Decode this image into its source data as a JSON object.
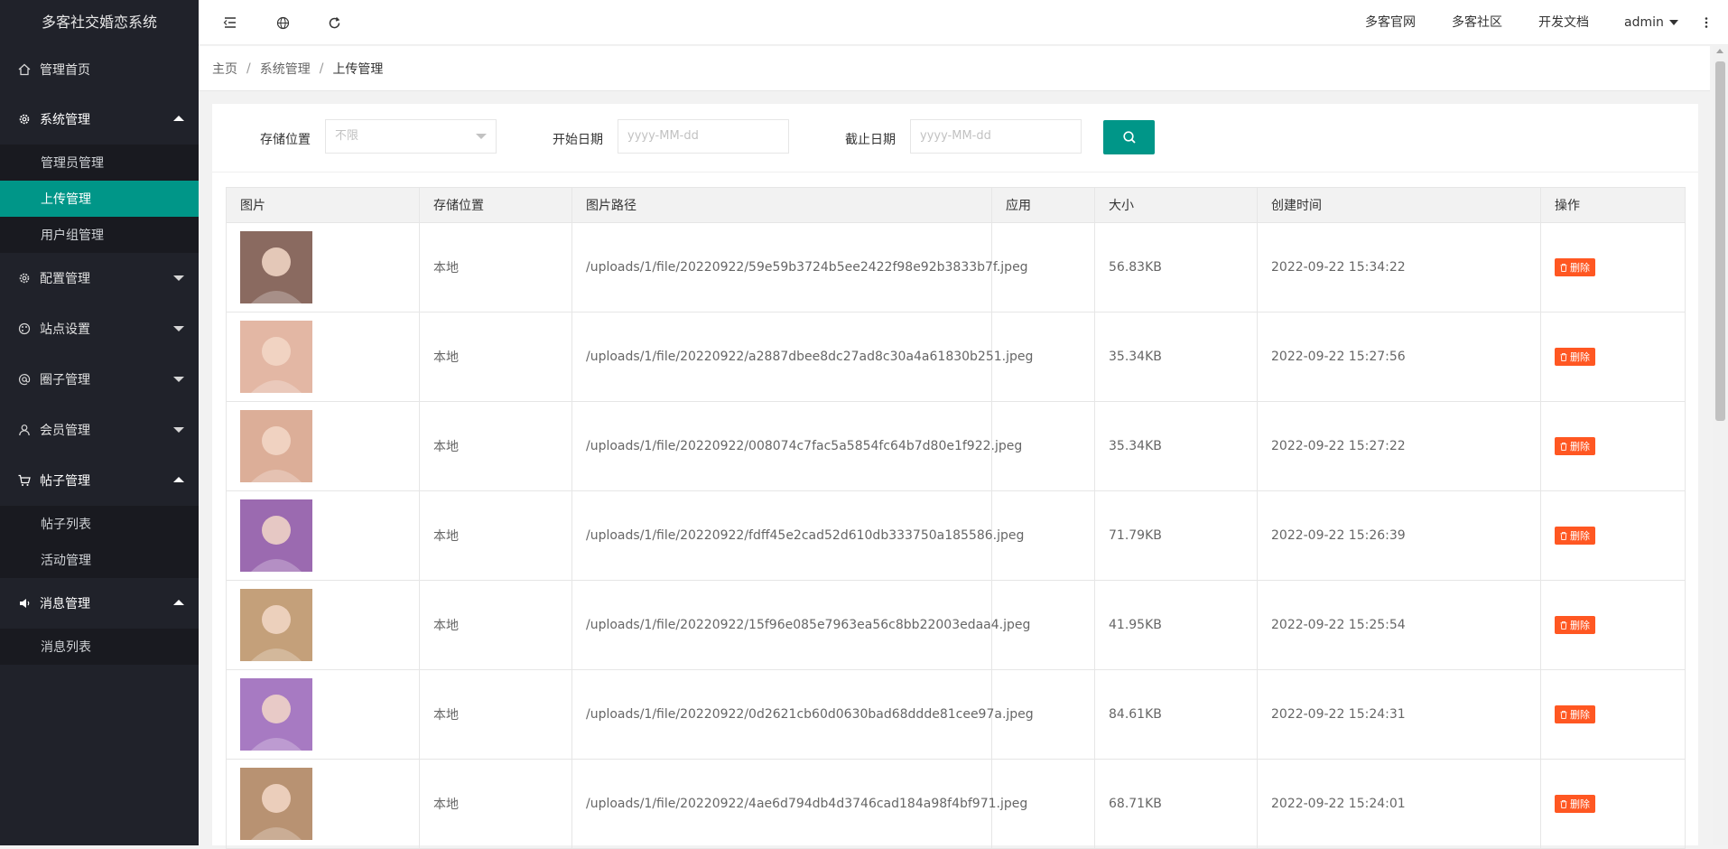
{
  "app": {
    "title": "多客社交婚恋系统"
  },
  "sidebar": {
    "items": [
      {
        "label": "管理首页",
        "icon": "home-icon"
      },
      {
        "label": "系统管理",
        "icon": "gear-icon",
        "expanded": true,
        "children": [
          {
            "label": "管理员管理"
          },
          {
            "label": "上传管理",
            "active": true
          },
          {
            "label": "用户组管理"
          }
        ]
      },
      {
        "label": "配置管理",
        "icon": "settings-icon"
      },
      {
        "label": "站点设置",
        "icon": "palette-icon"
      },
      {
        "label": "圈子管理",
        "icon": "at-icon"
      },
      {
        "label": "会员管理",
        "icon": "user-icon"
      },
      {
        "label": "帖子管理",
        "icon": "cart-icon",
        "expanded": true,
        "children": [
          {
            "label": "帖子列表"
          },
          {
            "label": "活动管理"
          }
        ]
      },
      {
        "label": "消息管理",
        "icon": "speaker-icon",
        "expanded": true,
        "children": [
          {
            "label": "消息列表"
          }
        ]
      }
    ]
  },
  "header": {
    "links": [
      "多客官网",
      "多客社区",
      "开发文档"
    ],
    "user": "admin"
  },
  "breadcrumb": [
    "主页",
    "系统管理",
    "上传管理"
  ],
  "filters": {
    "storage_label": "存储位置",
    "storage_value": "不限",
    "start_label": "开始日期",
    "start_placeholder": "yyyy-MM-dd",
    "end_label": "截止日期",
    "end_placeholder": "yyyy-MM-dd"
  },
  "table": {
    "columns": [
      "图片",
      "存储位置",
      "图片路径",
      "应用",
      "大小",
      "创建时间",
      "操作"
    ],
    "delete_label": "删除",
    "rows": [
      {
        "storage": "本地",
        "path": "/uploads/1/file/20220922/59e59b3724b5ee2422f98e92b3833b7f.jpeg",
        "app": "",
        "size": "56.83KB",
        "time": "2022-09-22 15:34:22",
        "tone": "#8a6a60"
      },
      {
        "storage": "本地",
        "path": "/uploads/1/file/20220922/a2887dbee8dc27ad8c30a4a61830b251.jpeg",
        "app": "",
        "size": "35.34KB",
        "time": "2022-09-22 15:27:56",
        "tone": "#e3b7a4"
      },
      {
        "storage": "本地",
        "path": "/uploads/1/file/20220922/008074c7fac5a5854fc64b7d80e1f922.jpeg",
        "app": "",
        "size": "35.34KB",
        "time": "2022-09-22 15:27:22",
        "tone": "#dcae98"
      },
      {
        "storage": "本地",
        "path": "/uploads/1/file/20220922/fdff45e2cad52d610db333750a185586.jpeg",
        "app": "",
        "size": "71.79KB",
        "time": "2022-09-22 15:26:39",
        "tone": "#9b6ab0"
      },
      {
        "storage": "本地",
        "path": "/uploads/1/file/20220922/15f96e085e7963ea56c8bb22003edaa4.jpeg",
        "app": "",
        "size": "41.95KB",
        "time": "2022-09-22 15:25:54",
        "tone": "#c4a07a"
      },
      {
        "storage": "本地",
        "path": "/uploads/1/file/20220922/0d2621cb60d0630bad68ddde81cee97a.jpeg",
        "app": "",
        "size": "84.61KB",
        "time": "2022-09-22 15:24:31",
        "tone": "#a77ac2"
      },
      {
        "storage": "本地",
        "path": "/uploads/1/file/20220922/4ae6d794db4d3746cad184a98f4bf971.jpeg",
        "app": "",
        "size": "68.71KB",
        "time": "2022-09-22 15:24:01",
        "tone": "#b89272"
      }
    ]
  },
  "colors": {
    "accent": "#009688",
    "danger": "#ff5722",
    "sidebar": "#20222a"
  }
}
